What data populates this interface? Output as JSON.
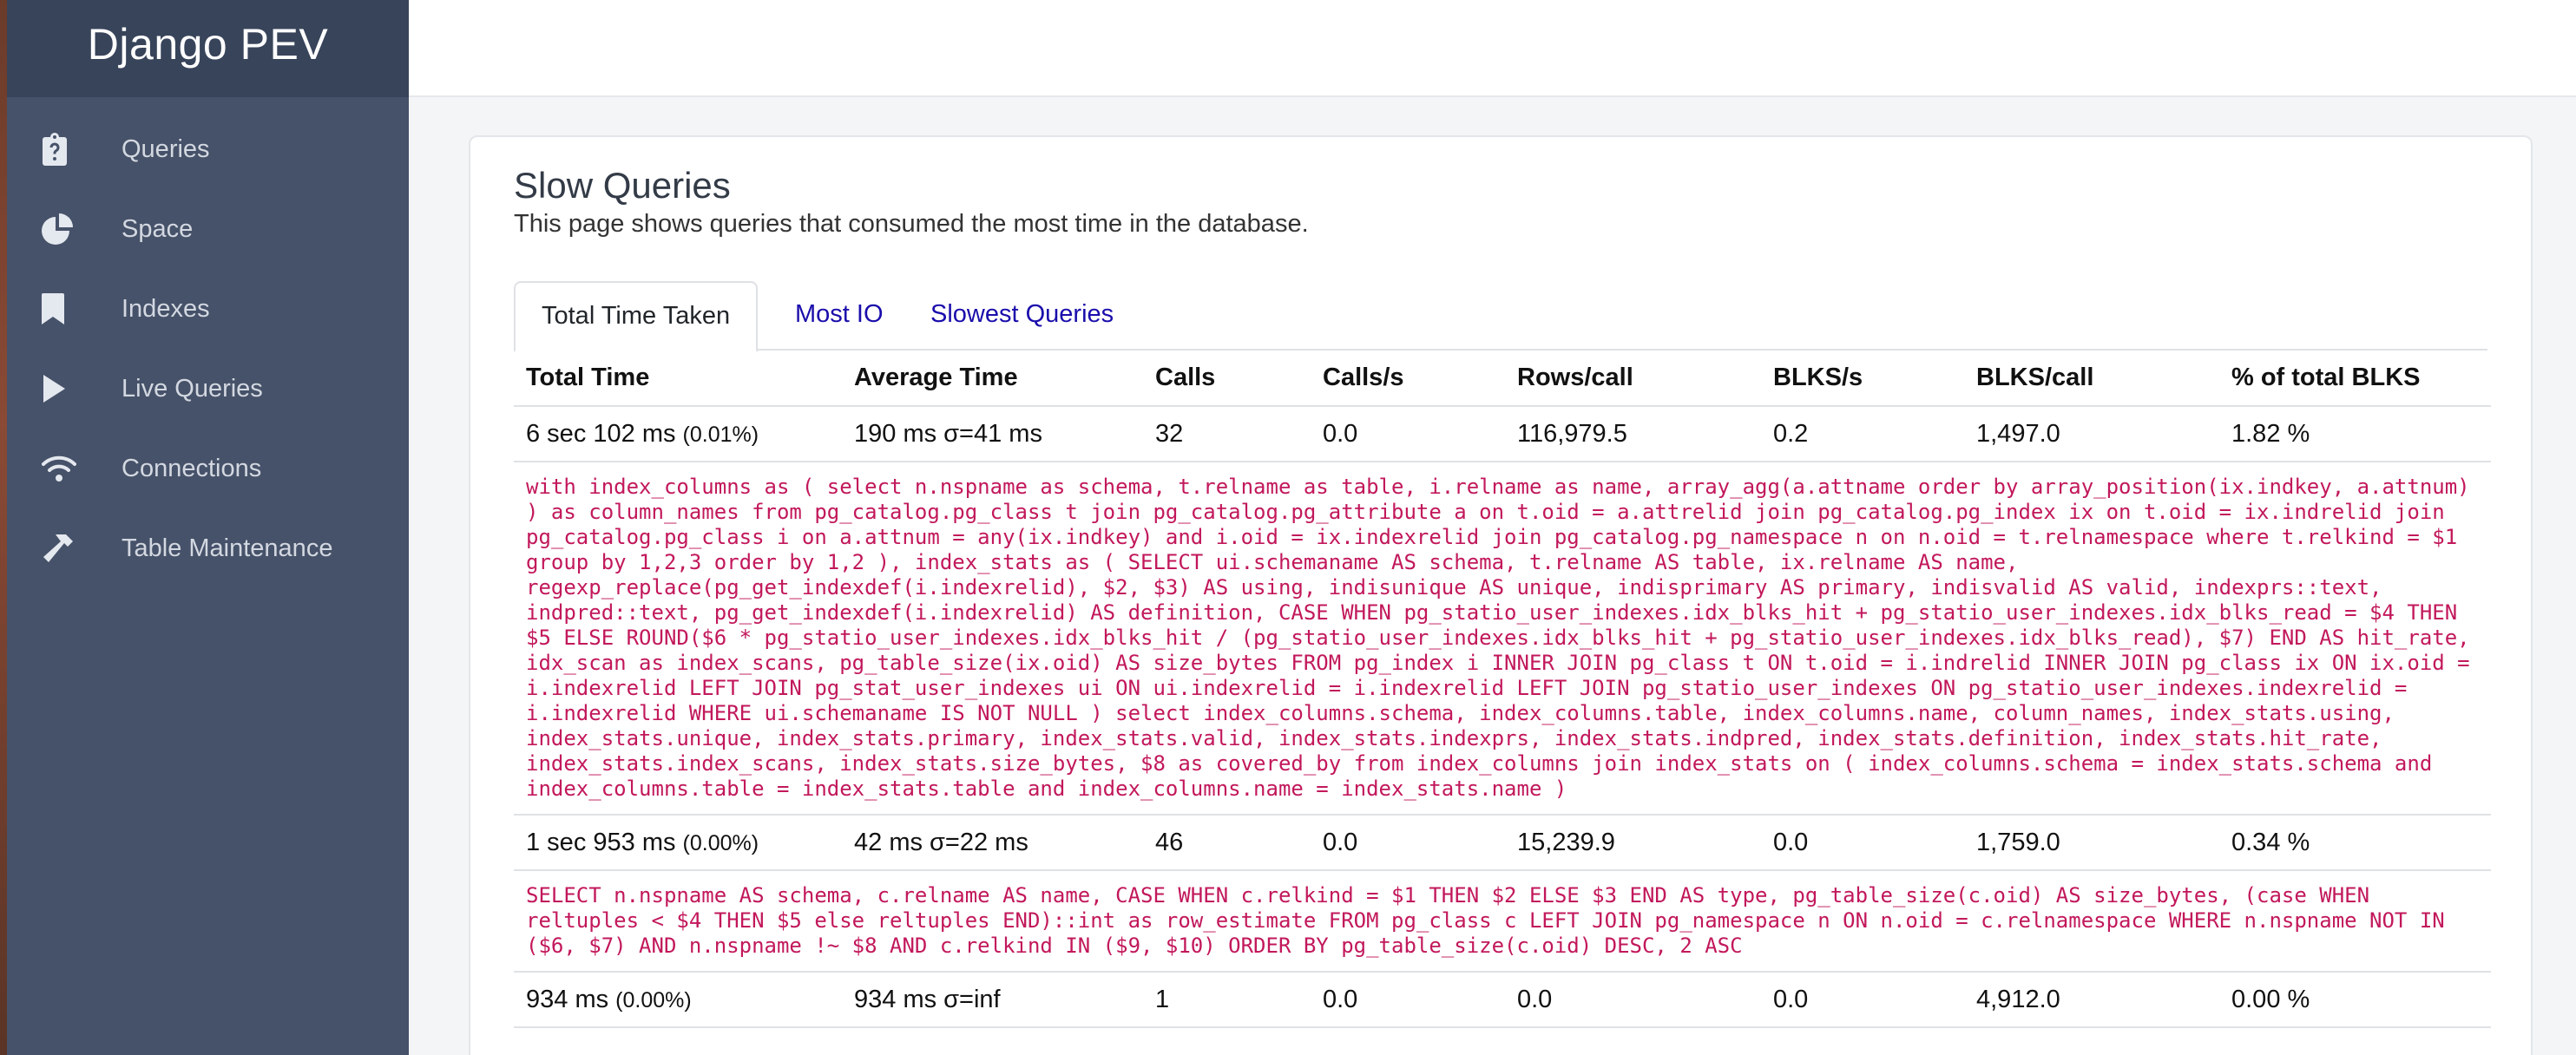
{
  "brand": "Django PEV",
  "sidebar": {
    "items": [
      {
        "label": "Queries",
        "icon": "clipboard-question-icon"
      },
      {
        "label": "Space",
        "icon": "pie-chart-icon"
      },
      {
        "label": "Indexes",
        "icon": "bookmark-icon"
      },
      {
        "label": "Live Queries",
        "icon": "play-icon"
      },
      {
        "label": "Connections",
        "icon": "wifi-icon"
      },
      {
        "label": "Table Maintenance",
        "icon": "hammer-icon"
      }
    ]
  },
  "page": {
    "title": "Slow Queries",
    "subtitle": "This page shows queries that consumed the most time in the database."
  },
  "tabs": [
    {
      "label": "Total Time Taken",
      "active": true
    },
    {
      "label": "Most IO",
      "active": false
    },
    {
      "label": "Slowest Queries",
      "active": false
    }
  ],
  "table": {
    "headers": [
      "Total Time",
      "Average Time",
      "Calls",
      "Calls/s",
      "Rows/call",
      "BLKS/s",
      "BLKS/call",
      "% of total BLKS"
    ],
    "rows": [
      {
        "total_time": "6 sec 102 ms",
        "total_pct": "(0.01%)",
        "average_time": "190 ms σ=41 ms",
        "calls": "32",
        "calls_per_s": "0.0",
        "rows_per_call": "116,979.5",
        "blks_per_s": "0.2",
        "blks_per_call": "1,497.0",
        "pct_total_blks": "1.82 %",
        "query": "with index_columns as ( select n.nspname as schema, t.relname as table, i.relname as name, array_agg(a.attname order by array_position(ix.indkey, a.attnum) ) as column_names from pg_catalog.pg_class t join pg_catalog.pg_attribute a on t.oid = a.attrelid join pg_catalog.pg_index ix on t.oid = ix.indrelid join pg_catalog.pg_class i on a.attnum = any(ix.indkey) and i.oid = ix.indexrelid join pg_catalog.pg_namespace n on n.oid = t.relnamespace where t.relkind = $1 group by 1,2,3 order by 1,2 ), index_stats as ( SELECT ui.schemaname AS schema, t.relname AS table, ix.relname AS name, regexp_replace(pg_get_indexdef(i.indexrelid), $2, $3) AS using, indisunique AS unique, indisprimary AS primary, indisvalid AS valid, indexprs::text, indpred::text, pg_get_indexdef(i.indexrelid) AS definition, CASE WHEN pg_statio_user_indexes.idx_blks_hit + pg_statio_user_indexes.idx_blks_read = $4 THEN $5 ELSE ROUND($6 * pg_statio_user_indexes.idx_blks_hit / (pg_statio_user_indexes.idx_blks_hit + pg_statio_user_indexes.idx_blks_read), $7) END AS hit_rate, idx_scan as index_scans, pg_table_size(ix.oid) AS size_bytes FROM pg_index i INNER JOIN pg_class t ON t.oid = i.indrelid INNER JOIN pg_class ix ON ix.oid = i.indexrelid LEFT JOIN pg_stat_user_indexes ui ON ui.indexrelid = i.indexrelid LEFT JOIN pg_statio_user_indexes ON pg_statio_user_indexes.indexrelid = i.indexrelid WHERE ui.schemaname IS NOT NULL ) select index_columns.schema, index_columns.table, index_columns.name, column_names, index_stats.using, index_stats.unique, index_stats.primary, index_stats.valid, index_stats.indexprs, index_stats.indpred, index_stats.definition, index_stats.hit_rate, index_stats.index_scans, index_stats.size_bytes, $8 as covered_by from index_columns join index_stats on ( index_columns.schema = index_stats.schema and index_columns.table = index_stats.table and index_columns.name = index_stats.name )"
      },
      {
        "total_time": "1 sec 953 ms",
        "total_pct": "(0.00%)",
        "average_time": "42 ms σ=22 ms",
        "calls": "46",
        "calls_per_s": "0.0",
        "rows_per_call": "15,239.9",
        "blks_per_s": "0.0",
        "blks_per_call": "1,759.0",
        "pct_total_blks": "0.34 %",
        "query": "SELECT n.nspname AS schema, c.relname AS name, CASE WHEN c.relkind = $1 THEN $2 ELSE $3 END AS type, pg_table_size(c.oid) AS size_bytes, (case WHEN reltuples < $4 THEN $5 else reltuples END)::int as row_estimate FROM pg_class c LEFT JOIN pg_namespace n ON n.oid = c.relnamespace WHERE n.nspname NOT IN ($6, $7) AND n.nspname !~ $8 AND c.relkind IN ($9, $10) ORDER BY pg_table_size(c.oid) DESC, 2 ASC"
      },
      {
        "total_time": "934 ms",
        "total_pct": "(0.00%)",
        "average_time": "934 ms σ=inf",
        "calls": "1",
        "calls_per_s": "0.0",
        "rows_per_call": "0.0",
        "blks_per_s": "0.0",
        "blks_per_call": "4,912.0",
        "pct_total_blks": "0.00 %",
        "query": ""
      }
    ]
  }
}
